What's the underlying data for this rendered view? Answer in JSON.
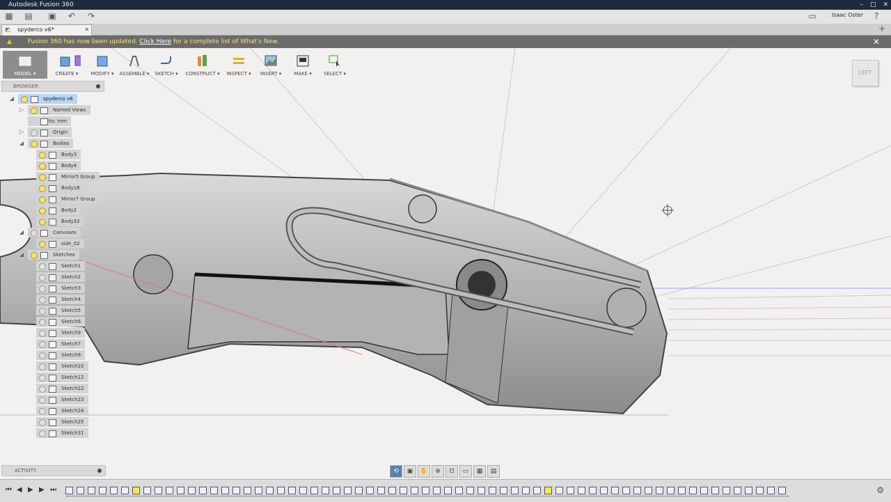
{
  "app": {
    "title": "Autodesk Fusion 360",
    "user": "Isaac Oster"
  },
  "document": {
    "tab_label": "spyderco v6*"
  },
  "notice": {
    "text_before": "Fusion 360 has now been updated.",
    "link": "Click Here",
    "text_after": "for a complete list of What's New."
  },
  "toolbar": {
    "items": [
      {
        "label": "MODEL ▾"
      },
      {
        "label": "CREATE ▾"
      },
      {
        "label": "MODIFY ▾"
      },
      {
        "label": "ASSEMBLE ▾"
      },
      {
        "label": "SKETCH ▾"
      },
      {
        "label": "CONSTRUCT ▾"
      },
      {
        "label": "INSPECT ▾"
      },
      {
        "label": "INSERT ▾"
      },
      {
        "label": "MAKE ▾"
      },
      {
        "label": "SELECT ▾"
      }
    ]
  },
  "browser": {
    "title": "BROWSER",
    "nodes": [
      {
        "label": "spyderco v6"
      },
      {
        "label": "Named Views"
      },
      {
        "label": "Units: mm"
      },
      {
        "label": "Origin"
      },
      {
        "label": "Bodies"
      },
      {
        "label": "Body3"
      },
      {
        "label": "Body4"
      },
      {
        "label": "Mirror5 Group"
      },
      {
        "label": "Body18"
      },
      {
        "label": "Mirror7 Group"
      },
      {
        "label": "Body2"
      },
      {
        "label": "Body32"
      },
      {
        "label": "Canvases"
      },
      {
        "label": "side_02"
      },
      {
        "label": "Sketches"
      },
      {
        "label": "Sketch1"
      },
      {
        "label": "Sketch2"
      },
      {
        "label": "Sketch3"
      },
      {
        "label": "Sketch4"
      },
      {
        "label": "Sketch5"
      },
      {
        "label": "Sketch6"
      },
      {
        "label": "Sketch9"
      },
      {
        "label": "Sketch7"
      },
      {
        "label": "Sketch8"
      },
      {
        "label": "Sketch10"
      },
      {
        "label": "Sketch12"
      },
      {
        "label": "Sketch22"
      },
      {
        "label": "Sketch23"
      },
      {
        "label": "Sketch24"
      },
      {
        "label": "Sketch25"
      },
      {
        "label": "Sketch31"
      }
    ]
  },
  "viewcube": {
    "face": "LEFT"
  },
  "activity": {
    "label": "ACTIVITY"
  },
  "colors": {
    "title_bar": "#1f2b3a",
    "notice_bar": "#6b6b6b",
    "selected_node": "#b9d6f2",
    "feature_highlight": "#f2ea50"
  }
}
